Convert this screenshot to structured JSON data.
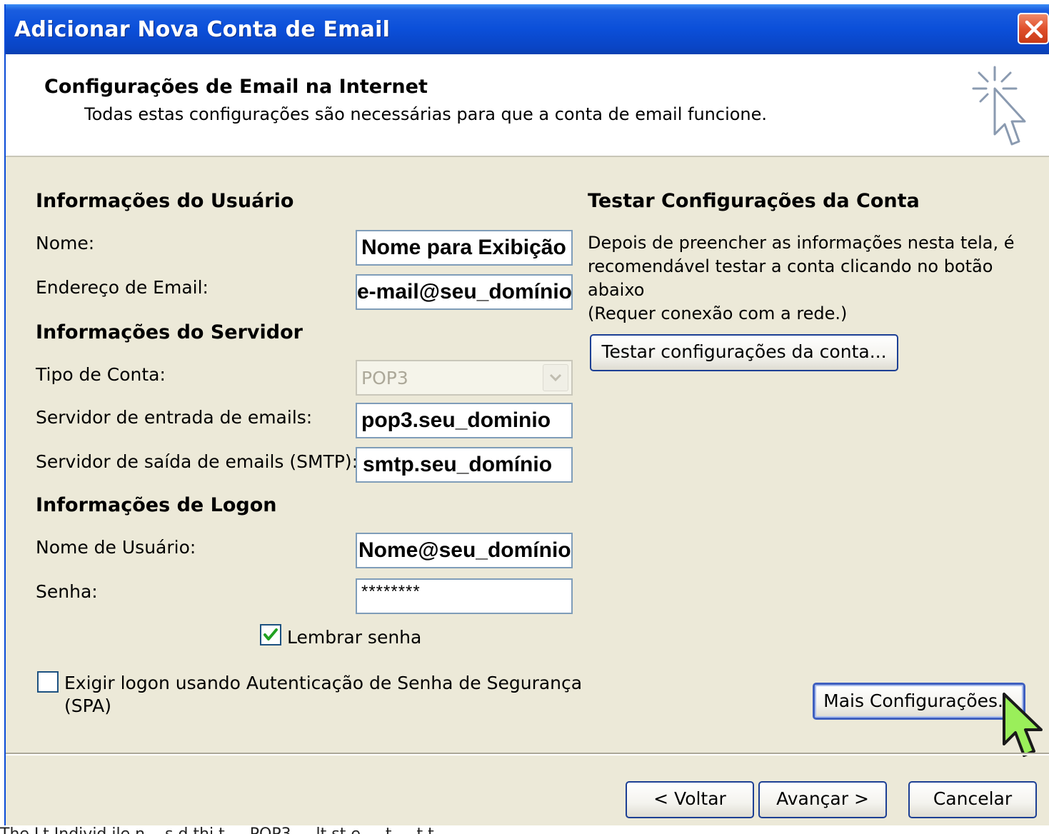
{
  "window": {
    "title": "Adicionar Nova Conta de Email"
  },
  "header": {
    "title": "Configurações de Email na Internet",
    "subtitle": "Todas estas configurações são necessárias para que a conta de email funcione."
  },
  "user_info": {
    "section_title": "Informações do Usuário",
    "name_label": "Nome:",
    "name_value": "Nome para Exibição",
    "email_label": "Endereço de Email:",
    "email_value": "e-mail@seu_domínio"
  },
  "server_info": {
    "section_title": "Informações do Servidor",
    "account_type_label": "Tipo de Conta:",
    "account_type_value": "POP3",
    "incoming_label": "Servidor de entrada de emails:",
    "incoming_value": "pop3.seu_dominio",
    "outgoing_label": "Servidor de saída de emails (SMTP):",
    "outgoing_value": "smtp.seu_domínio"
  },
  "logon_info": {
    "section_title": "Informações de Logon",
    "username_label": "Nome de Usuário:",
    "username_value": "Nome@seu_domínio",
    "password_label": "Senha:",
    "password_value": "********",
    "remember_label": "Lembrar senha",
    "remember_checked": true,
    "spa_label_line1": "Exigir logon usando Autenticação de Senha de Segurança",
    "spa_label_line2": "(SPA)",
    "spa_checked": false
  },
  "test": {
    "section_title": "Testar Configurações da Conta",
    "description_line1": "Depois de preencher as informações nesta tela, é",
    "description_line2": "recomendável testar a conta clicando no botão abaixo",
    "description_line3": "(Requer conexão com a rede.)",
    "test_button": "Testar configurações da conta..."
  },
  "buttons": {
    "more_settings": "Mais Configurações...",
    "back": "< Voltar",
    "next": "Avançar >",
    "cancel": "Cancelar"
  },
  "caption": "The Lt Individ ile n ...s d thi t ... POP3 ... lt st e ... t ... t t"
}
